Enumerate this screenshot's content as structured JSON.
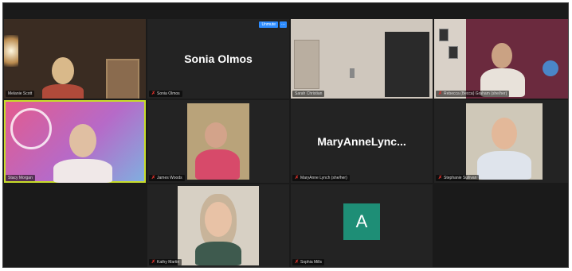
{
  "participants": [
    {
      "name": "Melanie Scott",
      "muted": false
    },
    {
      "name": "Sonia Olmos",
      "display_name": "Sonia Olmos",
      "muted": true,
      "unmute_label": "Unmute",
      "more_label": "..."
    },
    {
      "name": "Sarah Christian",
      "muted": false
    },
    {
      "name": "Rebecca (Becca) Graham (she/her)",
      "muted": true
    },
    {
      "name": "Stacy Morgan",
      "muted": false
    },
    {
      "name": "James Woods",
      "muted": true
    },
    {
      "name": "MaryAnne Lynch (she/her)",
      "display_name": "MaryAnneLync...",
      "muted": true
    },
    {
      "name": "Stephanie Sullivan",
      "muted": true
    },
    {
      "name": "Kathy Martin",
      "muted": true
    },
    {
      "name": "Sophia Mills",
      "avatar_letter": "A",
      "muted": true
    }
  ],
  "colors": {
    "accent": "#2d8cff",
    "active_speaker": "#c8dd2a",
    "muted": "#e0312a",
    "avatar": "#1e8e76"
  },
  "icons": {
    "mute": "microphone-muted-icon",
    "more": "more-options-icon"
  }
}
